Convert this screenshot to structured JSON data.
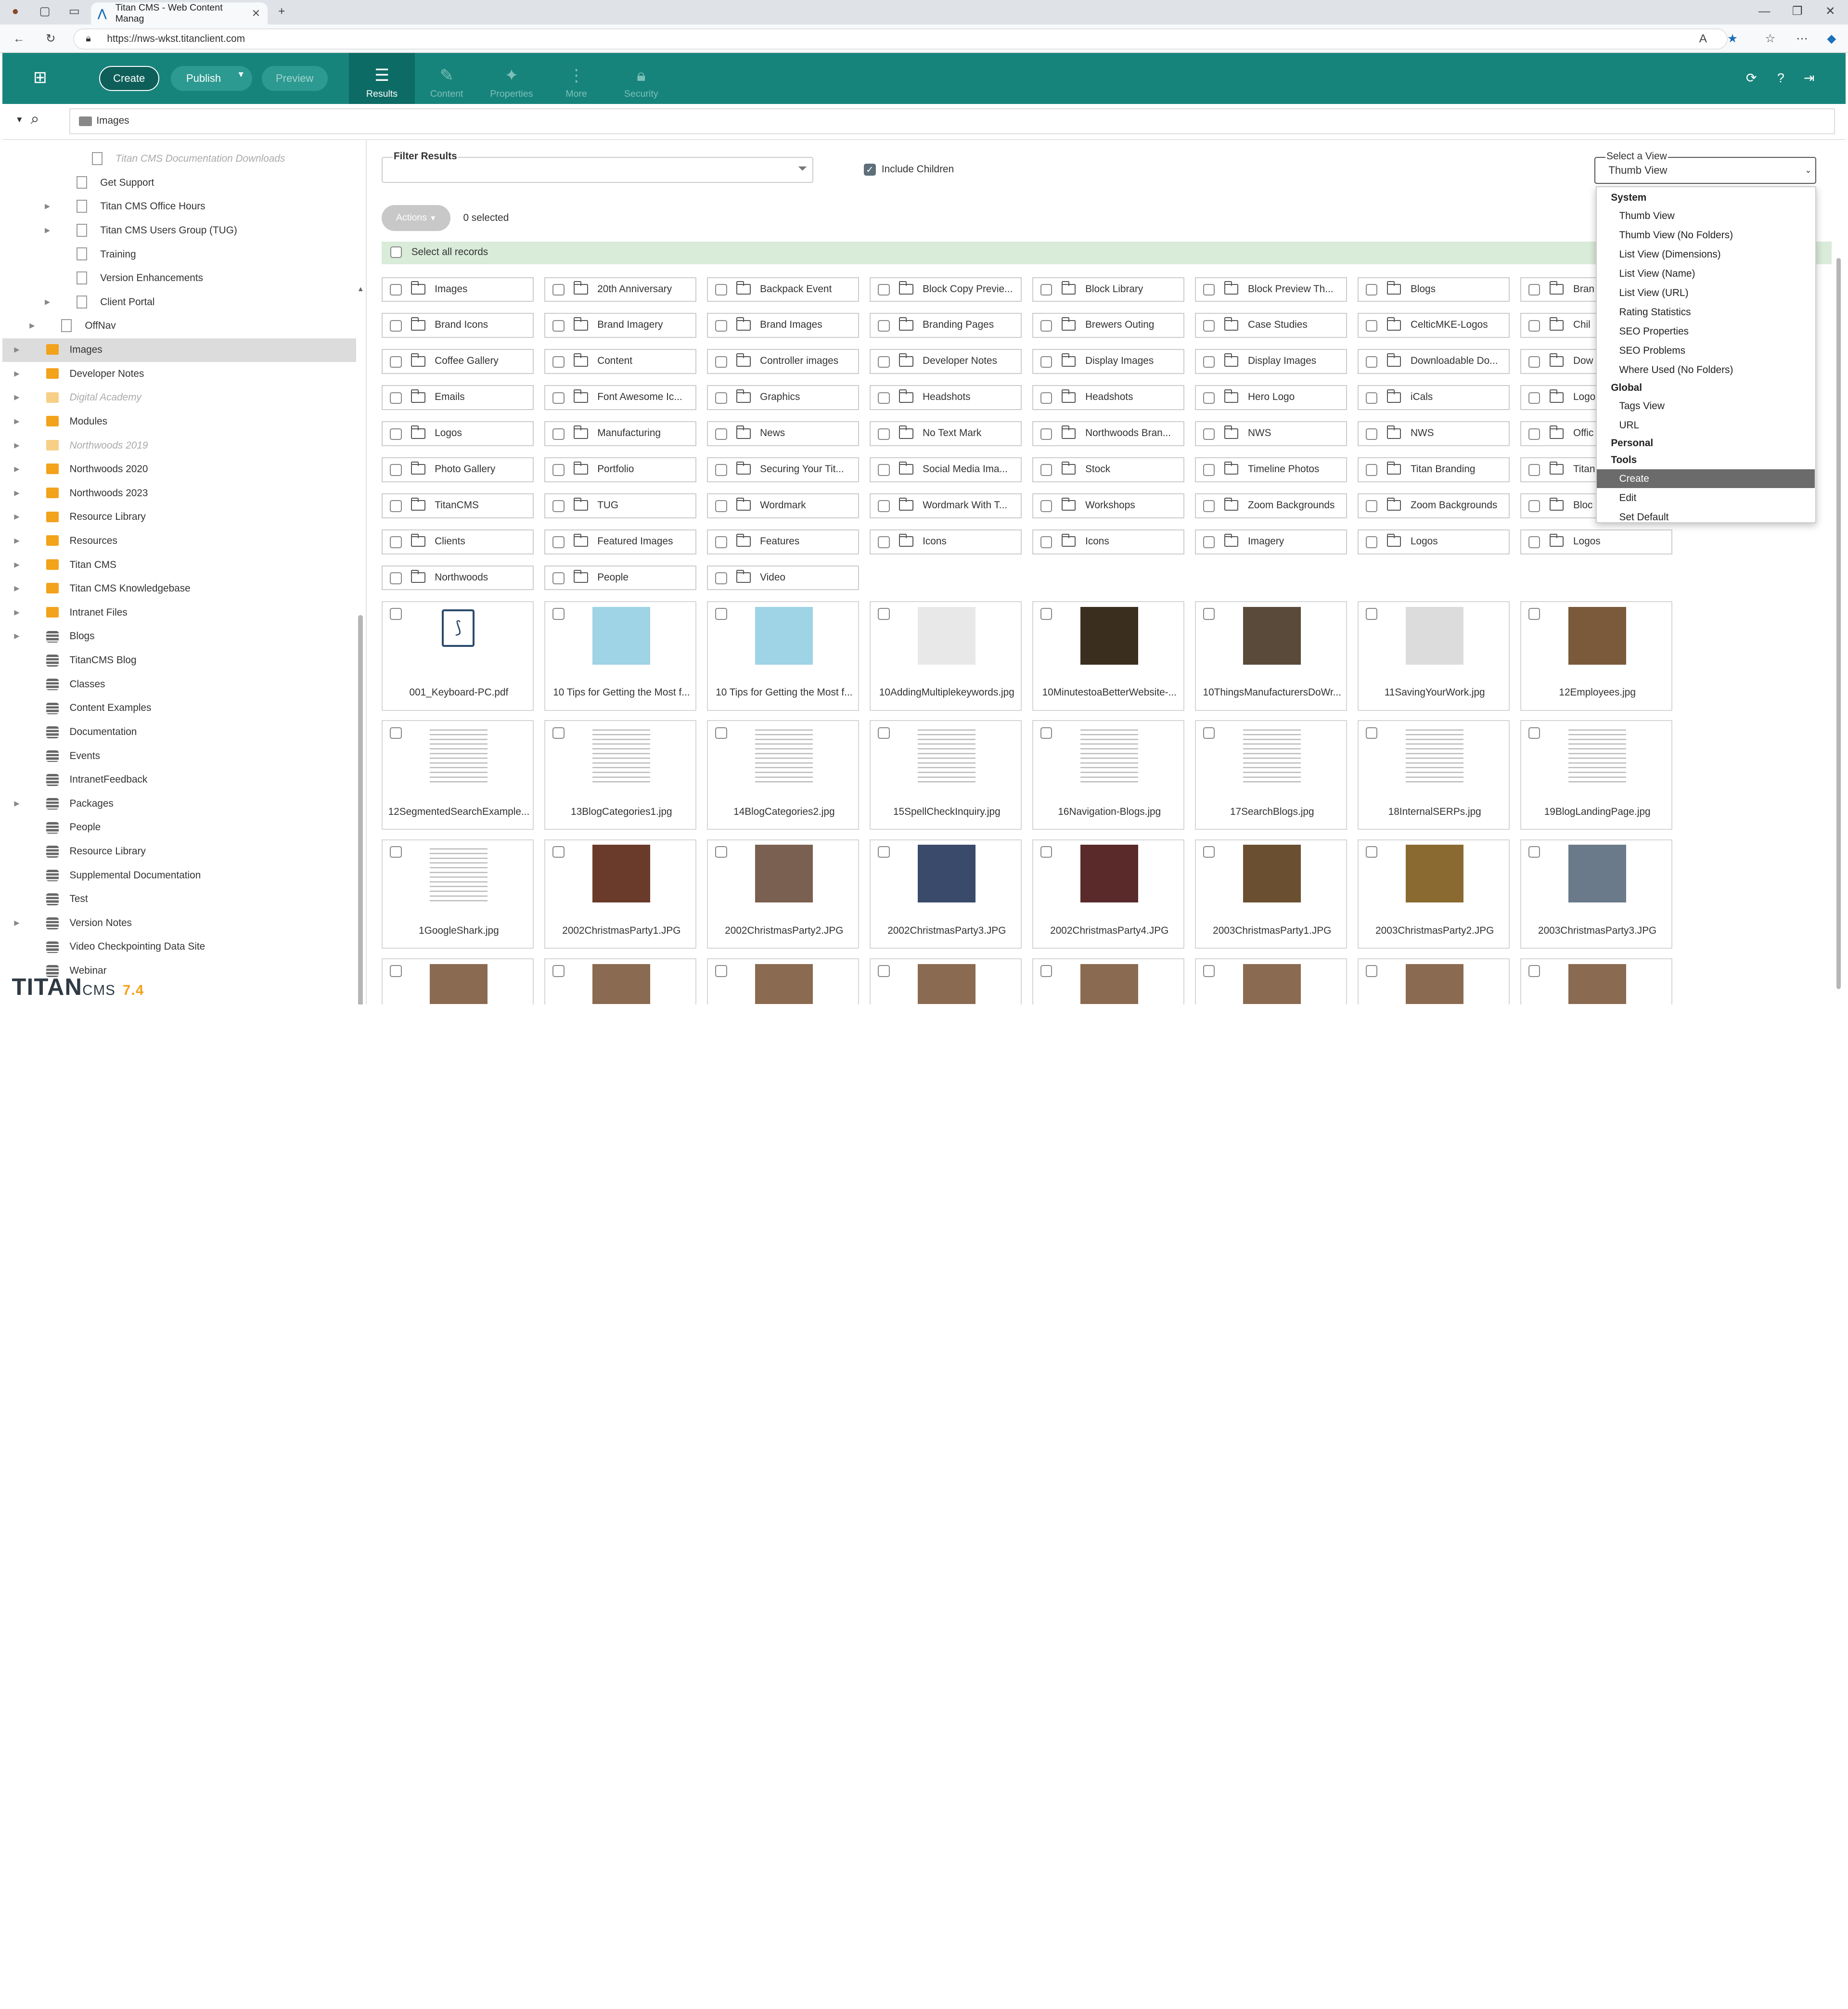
{
  "browser": {
    "tab_title": "Titan CMS - Web Content Manag",
    "url": "https://nws-wkst.titanclient.com"
  },
  "header": {
    "create_label": "Create",
    "publish_label": "Publish",
    "preview_label": "Preview",
    "nav": [
      {
        "label": "Results",
        "icon": "list-icon",
        "active": true
      },
      {
        "label": "Content",
        "icon": "pencil-icon",
        "active": false
      },
      {
        "label": "Properties",
        "icon": "wrench-icon",
        "active": false
      },
      {
        "label": "More",
        "icon": "more-icon",
        "active": false
      },
      {
        "label": "Security",
        "icon": "lock-icon",
        "active": false
      }
    ],
    "accent": "#17847c"
  },
  "search": {
    "path": "Images"
  },
  "tree": [
    {
      "label": "Titan CMS Documentation Downloads",
      "icon": "page",
      "indent": 5,
      "dim": true
    },
    {
      "label": "Get Support",
      "icon": "page",
      "indent": 4
    },
    {
      "label": "Titan CMS Office Hours",
      "icon": "page",
      "indent": 4,
      "caret": true
    },
    {
      "label": "Titan CMS Users Group (TUG)",
      "icon": "page",
      "indent": 4,
      "caret": true
    },
    {
      "label": "Training",
      "icon": "page",
      "indent": 4
    },
    {
      "label": "Version Enhancements",
      "icon": "page",
      "indent": 4
    },
    {
      "label": "Client Portal",
      "icon": "page",
      "indent": 4,
      "caret": true
    },
    {
      "label": "OffNav",
      "icon": "page",
      "indent": 3,
      "caret": true
    },
    {
      "label": "Images",
      "icon": "folder",
      "indent": 2,
      "caret": true,
      "selected": true
    },
    {
      "label": "Developer Notes",
      "icon": "folder",
      "indent": 2,
      "caret": true
    },
    {
      "label": "Digital Academy",
      "icon": "folder",
      "indent": 2,
      "caret": true,
      "dim": true
    },
    {
      "label": "Modules",
      "icon": "folder",
      "indent": 2,
      "caret": true
    },
    {
      "label": "Northwoods 2019",
      "icon": "folder",
      "indent": 2,
      "caret": true,
      "dim": true
    },
    {
      "label": "Northwoods 2020",
      "icon": "folder",
      "indent": 2,
      "caret": true
    },
    {
      "label": "Northwoods 2023",
      "icon": "folder",
      "indent": 2,
      "caret": true
    },
    {
      "label": "Resource Library",
      "icon": "folder",
      "indent": 2,
      "caret": true
    },
    {
      "label": "Resources",
      "icon": "folder",
      "indent": 2,
      "caret": true
    },
    {
      "label": "Titan CMS",
      "icon": "folder",
      "indent": 2,
      "caret": true
    },
    {
      "label": "Titan CMS Knowledgebase",
      "icon": "folder",
      "indent": 2,
      "caret": true
    },
    {
      "label": "Intranet Files",
      "icon": "folder",
      "indent": 2,
      "caret": true
    },
    {
      "label": "Blogs",
      "icon": "db",
      "indent": 2,
      "caret": true
    },
    {
      "label": "TitanCMS Blog",
      "icon": "db",
      "indent": 2
    },
    {
      "label": "Classes",
      "icon": "db",
      "indent": 2
    },
    {
      "label": "Content Examples",
      "icon": "db",
      "indent": 2
    },
    {
      "label": "Documentation",
      "icon": "db",
      "indent": 2
    },
    {
      "label": "Events",
      "icon": "db",
      "indent": 2
    },
    {
      "label": "IntranetFeedback",
      "icon": "db",
      "indent": 2
    },
    {
      "label": "Packages",
      "icon": "db",
      "indent": 2,
      "caret": true
    },
    {
      "label": "People",
      "icon": "db",
      "indent": 2
    },
    {
      "label": "Resource Library",
      "icon": "db",
      "indent": 2
    },
    {
      "label": "Supplemental Documentation",
      "icon": "db",
      "indent": 2
    },
    {
      "label": "Test",
      "icon": "db",
      "indent": 2
    },
    {
      "label": "Version Notes",
      "icon": "db",
      "indent": 2,
      "caret": true
    },
    {
      "label": "Video Checkpointing Data Site",
      "icon": "db",
      "indent": 2
    },
    {
      "label": "Webinar",
      "icon": "db",
      "indent": 2
    }
  ],
  "logo": {
    "brand": "TITAN",
    "cms": "CMS",
    "version": "7.4"
  },
  "main": {
    "filter_label": "Filter Results",
    "filter_placeholder": "",
    "include_children_label": "Include Children",
    "actions_label": "Actions",
    "selected_count": "0 selected",
    "select_all_label": "Select all records",
    "view_label": "Select a View",
    "view_value": "Thumb View",
    "folders": [
      [
        "Images",
        "20th Anniversary",
        "Backpack Event",
        "Block Copy Previe...",
        "Block Library",
        "Block Preview Th...",
        "Blogs",
        "Bran"
      ],
      [
        "Brand Icons",
        "Brand Imagery",
        "Brand Images",
        "Branding Pages",
        "Brewers Outing",
        "Case Studies",
        "CelticMKE-Logos",
        "Chil"
      ],
      [
        "Coffee Gallery",
        "Content",
        "Controller images",
        "Developer Notes",
        "Display Images",
        "Display Images",
        "Downloadable Do...",
        "Dow"
      ],
      [
        "Emails",
        "Font Awesome Ic...",
        "Graphics",
        "Headshots",
        "Headshots",
        "Hero Logo",
        "iCals",
        "Logo"
      ],
      [
        "Logos",
        "Manufacturing",
        "News",
        "No Text Mark",
        "Northwoods Bran...",
        "NWS",
        "NWS",
        "Offic"
      ],
      [
        "Photo Gallery",
        "Portfolio",
        "Securing Your Tit...",
        "Social Media Ima...",
        "Stock",
        "Timeline Photos",
        "Titan Branding",
        "Titan"
      ],
      [
        "TitanCMS",
        "TUG",
        "Wordmark",
        "Wordmark With T...",
        "Workshops",
        "Zoom Backgrounds",
        "Zoom Backgrounds",
        "Bloc"
      ],
      [
        "Clients",
        "Featured Images",
        "Features",
        "Icons",
        "Icons",
        "Imagery",
        "Logos",
        "Logos"
      ],
      [
        "Northwoods",
        "People",
        "Video"
      ]
    ],
    "thumbs": [
      [
        "001_Keyboard-PC.pdf",
        "10 Tips for Getting the Most f...",
        "10 Tips for Getting the Most f...",
        "10AddingMultiplekeywords.jpg",
        "10MinutestoaBetterWebsite-...",
        "10ThingsManufacturersDoWr...",
        "11SavingYourWork.jpg",
        "12Employees.jpg"
      ],
      [
        "12SegmentedSearchExample...",
        "13BlogCategories1.jpg",
        "14BlogCategories2.jpg",
        "15SpellCheckInquiry.jpg",
        "16Navigation-Blogs.jpg",
        "17SearchBlogs.jpg",
        "18InternalSERPs.jpg",
        "19BlogLandingPage.jpg"
      ],
      [
        "1GoogleShark.jpg",
        "2002ChristmasParty1.JPG",
        "2002ChristmasParty2.JPG",
        "2002ChristmasParty3.JPG",
        "2002ChristmasParty4.JPG",
        "2003ChristmasParty1.JPG",
        "2003ChristmasParty2.JPG",
        "2003ChristmasParty3.JPG"
      ],
      [
        "",
        "",
        "",
        "",
        "",
        "",
        "",
        ""
      ]
    ]
  },
  "view_menu": [
    {
      "type": "header",
      "label": "System"
    },
    {
      "type": "item",
      "label": "Thumb View"
    },
    {
      "type": "item",
      "label": "Thumb View (No Folders)"
    },
    {
      "type": "item",
      "label": "List View (Dimensions)"
    },
    {
      "type": "item",
      "label": "List View (Name)"
    },
    {
      "type": "item",
      "label": "List View (URL)"
    },
    {
      "type": "item",
      "label": "Rating Statistics"
    },
    {
      "type": "item",
      "label": "SEO Properties"
    },
    {
      "type": "item",
      "label": "SEO Problems"
    },
    {
      "type": "item",
      "label": "Where Used (No Folders)"
    },
    {
      "type": "header",
      "label": "Global"
    },
    {
      "type": "item",
      "label": "Tags View"
    },
    {
      "type": "item",
      "label": "URL"
    },
    {
      "type": "header",
      "label": "Personal"
    },
    {
      "type": "header",
      "label": "Tools"
    },
    {
      "type": "item",
      "label": "Create",
      "highlight": true
    },
    {
      "type": "item",
      "label": "Edit"
    },
    {
      "type": "item",
      "label": "Set Default"
    }
  ]
}
